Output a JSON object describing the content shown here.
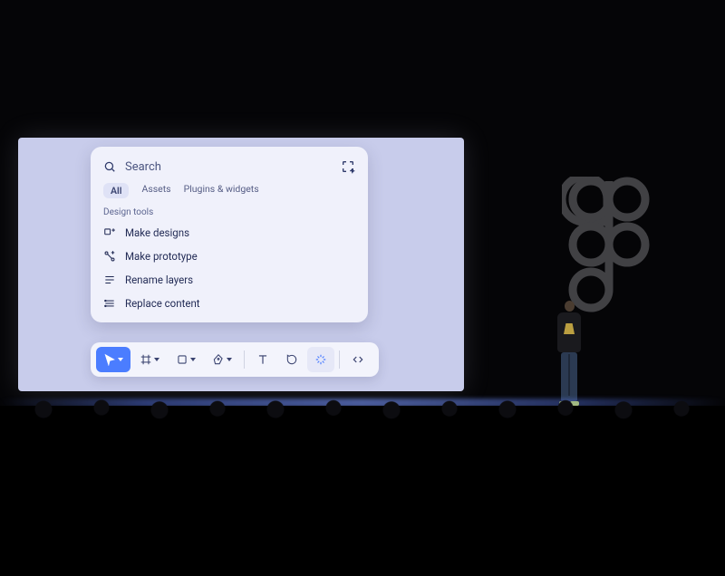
{
  "palette": {
    "search_placeholder": "Search",
    "tabs": [
      {
        "label": "All"
      },
      {
        "label": "Assets"
      },
      {
        "label": "Plugins & widgets"
      }
    ],
    "section_label": "Design tools",
    "commands": [
      {
        "icon": "make-designs-icon",
        "label": "Make designs"
      },
      {
        "icon": "make-prototype-icon",
        "label": "Make prototype"
      },
      {
        "icon": "rename-layers-icon",
        "label": "Rename layers"
      },
      {
        "icon": "replace-content-icon",
        "label": "Replace content"
      }
    ]
  },
  "toolbar": {
    "tools": [
      {
        "name": "move-tool",
        "icon": "cursor-icon",
        "active": true,
        "has_chevron": true
      },
      {
        "name": "frame-tool",
        "icon": "frame-icon",
        "active": false,
        "has_chevron": true
      },
      {
        "name": "shape-tool",
        "icon": "square-icon",
        "active": false,
        "has_chevron": true
      },
      {
        "name": "pen-tool",
        "icon": "pen-icon",
        "active": false,
        "has_chevron": true
      },
      {
        "name": "text-tool",
        "icon": "text-icon",
        "active": false,
        "has_chevron": false
      },
      {
        "name": "comment-tool",
        "icon": "comment-icon",
        "active": false,
        "has_chevron": false
      },
      {
        "name": "actions-tool",
        "icon": "sparkle-icon",
        "active": false,
        "has_chevron": false,
        "pill": true
      },
      {
        "name": "dev-mode-tool",
        "icon": "code-icon",
        "active": false,
        "has_chevron": false,
        "separated": true
      }
    ]
  },
  "colors": {
    "accent": "#4b7dff",
    "panel_bg": "#f0f1fb",
    "screen_bg": "#c8cceb",
    "text_primary": "#232c56"
  }
}
